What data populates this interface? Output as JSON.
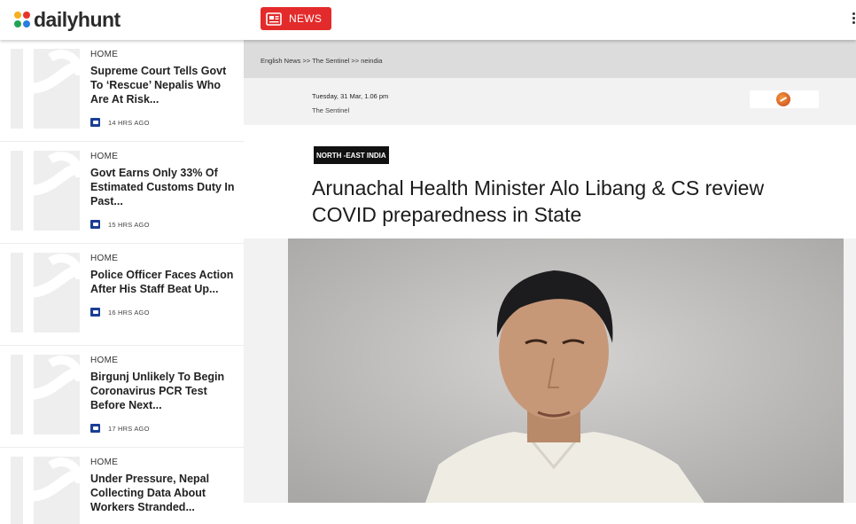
{
  "header": {
    "logo_text": "dailyhunt",
    "news_label": "NEWS",
    "news_icon": "newspaper-icon",
    "more_icon": "kebab-menu-icon"
  },
  "colors": {
    "accent": "#e32b2b",
    "logo_dot_colors": [
      "#f6b01e",
      "#e8332b",
      "#22a455",
      "#2a7de1"
    ],
    "badge_bg": "#111111"
  },
  "sidebar": {
    "items": [
      {
        "category": "HOME",
        "title": "Supreme Court Tells Govt To ‘Rescue’ Nepalis Who Are At Risk...",
        "time": "14 HRS AGO"
      },
      {
        "category": "HOME",
        "title": "Govt Earns Only 33% Of Estimated Customs Duty In Past...",
        "time": "15 HRS AGO"
      },
      {
        "category": "HOME",
        "title": "Police Officer Faces Action After His Staff Beat Up...",
        "time": "16 HRS AGO"
      },
      {
        "category": "HOME",
        "title": "Birgunj Unlikely To Begin Coronavirus PCR Test Before Next...",
        "time": "17 HRS AGO"
      },
      {
        "category": "HOME",
        "title": "Under Pressure, Nepal Collecting Data About Workers Stranded...",
        "time": ""
      }
    ]
  },
  "article": {
    "breadcrumb": "English News >> The Sentinel >> neindia",
    "date": "Tuesday, 31 Mar, 1.06 pm",
    "source": "The Sentinel",
    "category_badge": "NORTH -EAST INDIA",
    "headline": "Arunachal Health Minister Alo Libang & CS review COVID preparedness in State"
  }
}
